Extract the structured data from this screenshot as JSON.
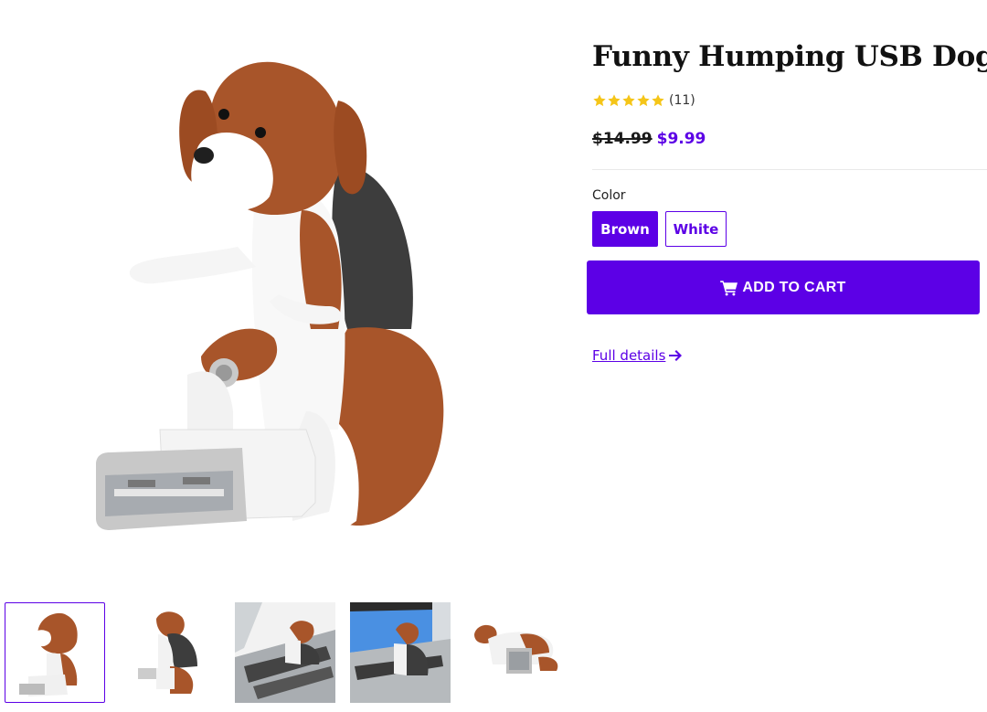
{
  "product": {
    "title": "Funny Humping USB Dog",
    "rating_count": "(11)",
    "rating_stars": 5,
    "price_compare": "$14.99",
    "price_sale": "$9.99",
    "option_label": "Color",
    "options": [
      "Brown",
      "White"
    ],
    "selected_option": "Brown",
    "add_to_cart_label": "ADD TO CART",
    "full_details_label": "Full details"
  },
  "gallery": {
    "thumbnail_count": 5,
    "active_thumbnail": 1
  },
  "colors": {
    "accent": "#5c00e6",
    "star": "#f5c518"
  },
  "icons": [
    "cart-icon",
    "arrow-right-icon",
    "star-icon"
  ]
}
